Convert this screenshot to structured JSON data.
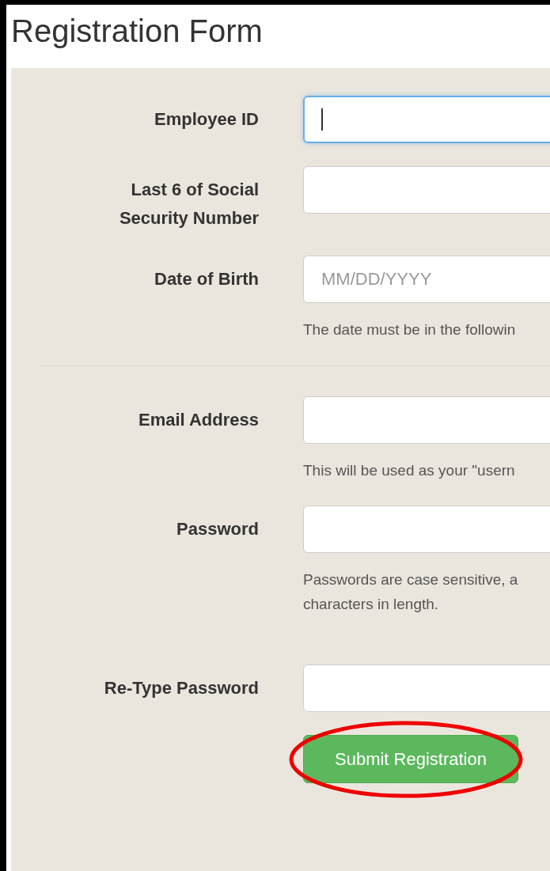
{
  "title": "Registration Form",
  "sections": [
    {
      "fields": [
        {
          "label": "Employee ID",
          "focused": true
        },
        {
          "label": "Last 6 of Social Security Number",
          "focused": false
        },
        {
          "label": "Date of Birth",
          "placeholder": "MM/DD/YYYY",
          "focused": false,
          "help": [
            "The date must be in the followin"
          ]
        }
      ]
    },
    {
      "fields": [
        {
          "label": "Email Address",
          "focused": false,
          "help": [
            "This will be used as your \"usern"
          ]
        },
        {
          "label": "Password",
          "focused": false,
          "help": [
            "Passwords are case sensitive, a",
            "characters in length."
          ]
        },
        {
          "label": "Re-Type Password",
          "focused": false
        }
      ]
    }
  ],
  "submit": {
    "label": "Submit Registration",
    "circled": true
  }
}
